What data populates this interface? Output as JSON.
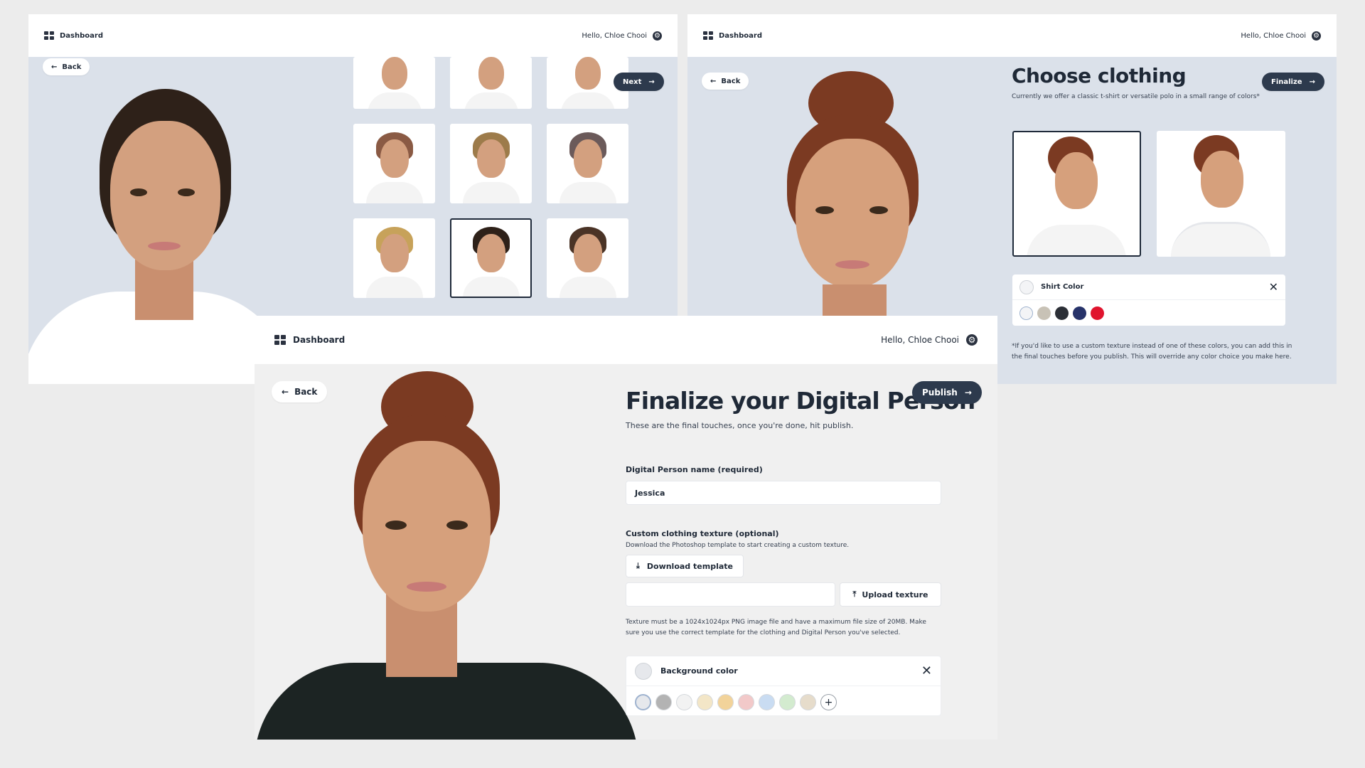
{
  "app": {
    "nav_label": "Dashboard",
    "greeting": "Hello, Chloe Chooi"
  },
  "screen1": {
    "back_label": "Back",
    "next_label": "Next"
  },
  "screen2": {
    "back_label": "Back",
    "title": "Choose clothing",
    "subtitle": "Currently we offer a classic t-shirt or versatile polo in a small range of colors*",
    "finalize_label": "Finalize",
    "shirt_color_label": "Shirt Color",
    "shirt_colors": [
      "#f3f4f6",
      "#c8c2b6",
      "#2b2f36",
      "#27336a",
      "#e0142e"
    ],
    "note": "*If you'd like to use a custom texture instead of one of these colors, you can add this in the final touches before you publish. This will override any color choice you make here."
  },
  "screen3": {
    "back_label": "Back",
    "title": "Finalize your Digital Person",
    "subtitle": "These are the final touches, once you're done, hit publish.",
    "publish_label": "Publish",
    "name_label": "Digital Person name (required)",
    "name_value": "Jessica",
    "texture_label": "Custom clothing texture (optional)",
    "texture_help": "Download the Photoshop template to start creating a custom texture.",
    "download_label": "Download template",
    "upload_label": "Upload texture",
    "texture_note": "Texture must be a 1024x1024px PNG image file and have a maximum file size of 20MB. Make sure you use the correct template for the clothing and Digital Person you've selected.",
    "bg_color_label": "Background color",
    "bg_colors": [
      "#e6e8ec",
      "#b3b3b3",
      "#f2f2f2",
      "#f3e6c7",
      "#f2d39a",
      "#f2c9c9",
      "#c9dcf2",
      "#d3ebcf",
      "#e6dccb"
    ],
    "add_symbol": "+"
  }
}
